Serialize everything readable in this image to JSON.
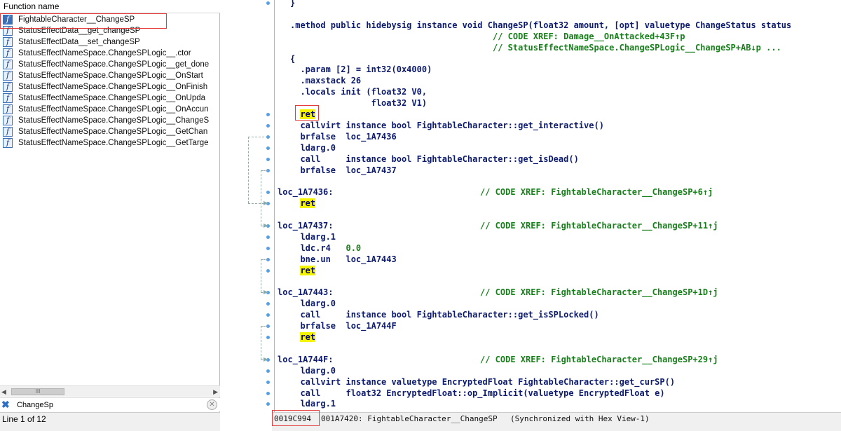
{
  "left_panel": {
    "header": "Function name",
    "functions": [
      {
        "name": "FightableCharacter__ChangeSP",
        "icon": "function-icon",
        "selected": true
      },
      {
        "name": "StatusEffectData__get_changeSP",
        "icon": "function-icon"
      },
      {
        "name": "StatusEffectData__set_changeSP",
        "icon": "function-icon"
      },
      {
        "name": "StatusEffectNameSpace.ChangeSPLogic__.ctor",
        "icon": "function-icon"
      },
      {
        "name": "StatusEffectNameSpace.ChangeSPLogic__get_done",
        "icon": "function-icon"
      },
      {
        "name": "StatusEffectNameSpace.ChangeSPLogic__OnStart",
        "icon": "function-icon"
      },
      {
        "name": "StatusEffectNameSpace.ChangeSPLogic__OnFinish",
        "icon": "function-icon"
      },
      {
        "name": "StatusEffectNameSpace.ChangeSPLogic__OnUpda",
        "icon": "function-icon"
      },
      {
        "name": "StatusEffectNameSpace.ChangeSPLogic__OnAccun",
        "icon": "function-icon"
      },
      {
        "name": "StatusEffectNameSpace.ChangeSPLogic__ChangeS",
        "icon": "function-icon"
      },
      {
        "name": "StatusEffectNameSpace.ChangeSPLogic__GetChan",
        "icon": "function-icon"
      },
      {
        "name": "StatusEffectNameSpace.ChangeSPLogic__GetTarge",
        "icon": "function-icon"
      }
    ],
    "scroll_thumb": "III",
    "filter": {
      "value": "ChangeSp",
      "icon": "filter-icon"
    },
    "status": "Line 1 of 12"
  },
  "code": {
    "lines": [
      {
        "text": "}",
        "cls": ""
      },
      {
        "text": "",
        "cls": ""
      },
      {
        "text": ".method public hidebysig instance void ChangeSP(float32 amount, [opt] valuetype ChangeStatus status",
        "cls": ""
      },
      {
        "text": "                                        // CODE XREF: Damage__OnAttacked+43F↑p",
        "cls": "cmt"
      },
      {
        "text": "                                        // StatusEffectNameSpace.ChangeSPLogic__ChangeSP+AB↓p ...",
        "cls": "cmt"
      },
      {
        "text": "{",
        "cls": ""
      },
      {
        "text": "  .param [2] = int32(0x4000)",
        "cls": ""
      },
      {
        "text": "  .maxstack 26",
        "cls": ""
      },
      {
        "text": "  .locals init (float32 V0,",
        "cls": ""
      },
      {
        "text": "                float32 V1)",
        "cls": ""
      },
      {
        "text": "  ret",
        "cls": "ret"
      },
      {
        "text": "  callvirt instance bool FightableCharacter::get_interactive()",
        "cls": ""
      },
      {
        "text": "  brfalse  loc_1A7436",
        "cls": ""
      },
      {
        "text": "  ldarg.0",
        "cls": ""
      },
      {
        "text": "  call     instance bool FightableCharacter::get_isDead()",
        "cls": ""
      },
      {
        "text": "  brfalse  loc_1A7437",
        "cls": ""
      },
      {
        "text": "",
        "cls": ""
      },
      {
        "text": "loc_1A7436:                             // CODE XREF: FightableCharacter__ChangeSP+6↑j",
        "cls": "label"
      },
      {
        "text": "  ret",
        "cls": "ret"
      },
      {
        "text": "",
        "cls": ""
      },
      {
        "text": "loc_1A7437:                             // CODE XREF: FightableCharacter__ChangeSP+11↑j",
        "cls": "label"
      },
      {
        "text": "  ldarg.1",
        "cls": ""
      },
      {
        "text": "  ldc.r4   0.0",
        "cls": "num"
      },
      {
        "text": "  bne.un   loc_1A7443",
        "cls": ""
      },
      {
        "text": "  ret",
        "cls": "ret"
      },
      {
        "text": "",
        "cls": ""
      },
      {
        "text": "loc_1A7443:                             // CODE XREF: FightableCharacter__ChangeSP+1D↑j",
        "cls": "label"
      },
      {
        "text": "  ldarg.0",
        "cls": ""
      },
      {
        "text": "  call     instance bool FightableCharacter::get_isSPLocked()",
        "cls": ""
      },
      {
        "text": "  brfalse  loc_1A744F",
        "cls": ""
      },
      {
        "text": "  ret",
        "cls": "ret"
      },
      {
        "text": "",
        "cls": ""
      },
      {
        "text": "loc_1A744F:                             // CODE XREF: FightableCharacter__ChangeSP+29↑j",
        "cls": "label"
      },
      {
        "text": "  ldarg.0",
        "cls": ""
      },
      {
        "text": "  callvirt instance valuetype EncryptedFloat FightableCharacter::get_curSP()",
        "cls": ""
      },
      {
        "text": "  call     float32 EncryptedFloat::op_Implicit(valuetype EncryptedFloat e)",
        "cls": ""
      },
      {
        "text": "  ldarg.1",
        "cls": ""
      }
    ]
  },
  "status_bar": {
    "file_offset": "0019C994",
    "address_info": "001A7420: FightableCharacter__ChangeSP",
    "sync": "(Synchronized with Hex View-1)"
  },
  "colors": {
    "ret_highlight": "#f4f400",
    "code_text": "#0d1b6e",
    "comment": "#17801a",
    "annotation_box": "#e43c3c"
  }
}
